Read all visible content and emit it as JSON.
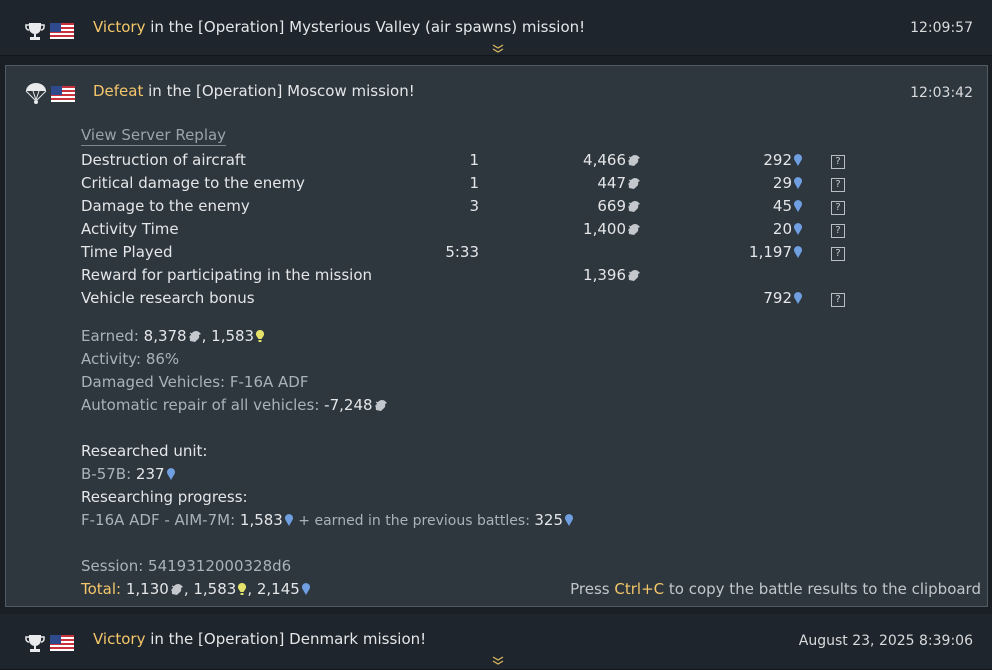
{
  "entries": [
    {
      "result": "Victory",
      "rest": " in the [Operation] Mysterious Valley (air spawns) mission!",
      "time": "12:09:57"
    },
    {
      "result": "Defeat",
      "rest": " in the [Operation] Moscow mission!",
      "time": "12:03:42"
    },
    {
      "result": "Victory",
      "rest": " in the [Operation] Denmark mission!",
      "time": "August 23, 2025 8:39:06"
    }
  ],
  "details": {
    "replay_link": "View Server Replay",
    "rewards": [
      {
        "label": "Destruction of aircraft",
        "count": "1",
        "sl": "4,466",
        "rp": "292",
        "help": "?"
      },
      {
        "label": "Critical damage to the enemy",
        "count": "1",
        "sl": "447",
        "rp": "29",
        "help": "?"
      },
      {
        "label": "Damage to the enemy",
        "count": "3",
        "sl": "669",
        "rp": "45",
        "help": "?"
      },
      {
        "label": "Activity Time",
        "count": "",
        "sl": "1,400",
        "rp": "20",
        "help": "?"
      },
      {
        "label": "Time Played",
        "count": "5:33",
        "sl": "",
        "rp": "1,197",
        "help": "?"
      },
      {
        "label": "Reward for participating in the mission",
        "count": "",
        "sl": "1,396",
        "rp": "",
        "help": ""
      },
      {
        "label": "Vehicle research bonus",
        "count": "",
        "sl": "",
        "rp": "792",
        "help": "?"
      }
    ],
    "earned_label": "Earned: ",
    "earned_sl": "8,378",
    "earned_sep": ", ",
    "earned_crp": "1,583",
    "activity_label": "Activity: 86%",
    "damaged_label": "Damaged Vehicles: F-16A ADF",
    "repair_label": "Automatic repair of all vehicles: ",
    "repair_value": "-7,248",
    "researched_unit_label": "Researched unit:",
    "researched_unit_name": "B-57B: ",
    "researched_unit_rp": "237",
    "researching_label": "Researching progress:",
    "researching_item": "F-16A ADF - AIM-7M: ",
    "researching_value": "1,583",
    "researching_prev_label": " + earned in the previous battles: ",
    "researching_prev_value": "325",
    "session_label": "Session: 5419312000328d6",
    "total_label": "Total: ",
    "total_sl": "1,130",
    "total_sep1": ", ",
    "total_crp": "1,583",
    "total_sep2": ", ",
    "total_rp": "2,145",
    "hint_pre": "Press ",
    "hint_key": "Ctrl+C",
    "hint_post": " to copy the battle results to the clipboard"
  },
  "colors": {
    "accent": "#f4c76a",
    "rp_icon": "#6f9fe0",
    "crp_icon": "#e4e26a",
    "sl_icon": "#c4c8cc"
  },
  "icons": [
    "trophy-icon",
    "parachute-icon",
    "us-flag-icon",
    "silver-lions-icon",
    "research-points-icon",
    "convertible-rp-icon",
    "help-icon",
    "chevron-down-icon"
  ]
}
